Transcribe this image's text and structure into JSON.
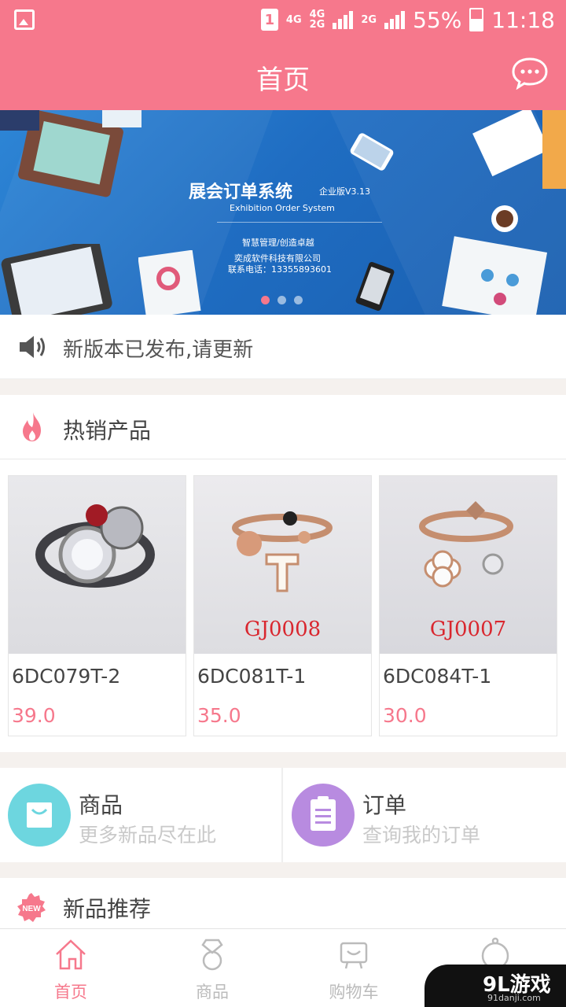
{
  "status_bar": {
    "sim": "1",
    "network_a": "4G",
    "network_b": "4G",
    "network_c": "2G",
    "network_d": "2G",
    "battery": "55%",
    "time": "11:18"
  },
  "header": {
    "title": "首页"
  },
  "banner": {
    "title": "展会订单系统",
    "edition": "企业版V3.13",
    "subtitle": "Exhibition Order System",
    "slogan": "智慧管理/创造卓越",
    "company": "奕成软件科技有限公司",
    "phone": "联系电话：13355893601",
    "active_slide": 1,
    "slide_count": 3
  },
  "notice": {
    "text": "新版本已发布,请更新"
  },
  "hot_section": {
    "title": "热销产品"
  },
  "products": [
    {
      "code": "6DC079T-2",
      "price": "39.0",
      "image_label": ""
    },
    {
      "code": "6DC081T-1",
      "price": "35.0",
      "image_label": "GJ0008"
    },
    {
      "code": "6DC084T-1",
      "price": "30.0",
      "image_label": "GJ0007"
    }
  ],
  "quick_links": [
    {
      "title": "商品",
      "subtitle": "更多新品尽在此",
      "color": "#6dd6df"
    },
    {
      "title": "订单",
      "subtitle": "查询我的订单",
      "color": "#b88be0"
    }
  ],
  "new_section": {
    "title": "新品推荐",
    "badge": "NEW"
  },
  "tabs": [
    {
      "label": "首页",
      "active": true
    },
    {
      "label": "商品",
      "active": false
    },
    {
      "label": "购物车",
      "active": false
    },
    {
      "label": "",
      "active": false
    }
  ],
  "watermark": {
    "text": "9L游戏",
    "sub": "91danji.com"
  },
  "colors": {
    "accent": "#f6788c",
    "banner": "#1f6dc2"
  }
}
